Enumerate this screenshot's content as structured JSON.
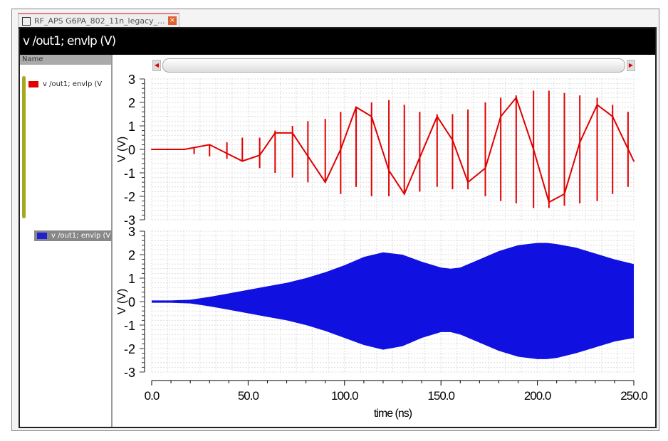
{
  "tab": {
    "title": "RF_APS G6PA_802_11n_legacy_...",
    "close": "×"
  },
  "window_title": "v /out1; envlp (V)",
  "panel": {
    "header": "Name",
    "traces": [
      {
        "label": "v /out1; envlp (V",
        "color": "#e00000"
      },
      {
        "label": "v /out1; envlp (V",
        "color": "#2020d0"
      }
    ]
  },
  "chart_data": [
    {
      "type": "line",
      "title": "v /out1; envlp (V)",
      "xlabel": "time (ns)",
      "ylabel": "V (V)",
      "xlim": [
        0,
        250
      ],
      "ylim": [
        -3,
        3
      ],
      "yticks": [
        "3",
        "2",
        "1",
        "0",
        "-1",
        "-2",
        "-3"
      ],
      "series": [
        {
          "name": "v /out1; envlp (V)",
          "color": "#e00000",
          "x": [
            0,
            17,
            30,
            47,
            56,
            64,
            73,
            90,
            98,
            106,
            114,
            123,
            131,
            148,
            156,
            164,
            173,
            181,
            189,
            198,
            206,
            214,
            222,
            231,
            239,
            250
          ],
          "y": [
            0,
            0,
            0.2,
            -0.5,
            -0.25,
            0.7,
            0.7,
            -1.4,
            0,
            1.8,
            1.4,
            -0.9,
            -1.9,
            1.4,
            0.4,
            -1.4,
            -0.8,
            1.4,
            2.2,
            0,
            -2.25,
            -1.9,
            0.3,
            1.9,
            1.4,
            -0.5
          ],
          "spikes": [
            [
              22,
              0.1,
              -0.2
            ],
            [
              30,
              0.2,
              -0.3
            ],
            [
              39,
              0.3,
              -0.4
            ],
            [
              47,
              0.5,
              -0.5
            ],
            [
              56,
              0.5,
              -0.8
            ],
            [
              64,
              0.8,
              -1.0
            ],
            [
              73,
              1.0,
              -1.2
            ],
            [
              81,
              1.2,
              -1.4
            ],
            [
              90,
              1.3,
              -1.4
            ],
            [
              98,
              1.6,
              -1.9
            ],
            [
              106,
              1.8,
              -1.6
            ],
            [
              114,
              2.0,
              -2.0
            ],
            [
              123,
              2.1,
              -2.0
            ],
            [
              131,
              1.9,
              -1.9
            ],
            [
              139,
              1.6,
              -1.8
            ],
            [
              148,
              1.5,
              -1.6
            ],
            [
              156,
              1.5,
              -1.7
            ],
            [
              164,
              1.7,
              -1.7
            ],
            [
              173,
              2.0,
              -2.0
            ],
            [
              181,
              2.2,
              -2.2
            ],
            [
              189,
              2.3,
              -2.3
            ],
            [
              198,
              2.5,
              -2.5
            ],
            [
              206,
              2.5,
              -2.5
            ],
            [
              214,
              2.4,
              -2.4
            ],
            [
              222,
              2.3,
              -2.3
            ],
            [
              231,
              2.2,
              -2.2
            ],
            [
              239,
              1.9,
              -1.9
            ],
            [
              247,
              1.6,
              -1.6
            ]
          ]
        }
      ]
    },
    {
      "type": "area",
      "xlabel": "time (ns)",
      "ylabel": "V (V)",
      "xlim": [
        0,
        250
      ],
      "ylim": [
        -3,
        3
      ],
      "yticks": [
        "3",
        "2",
        "1",
        "0",
        "-1",
        "-2",
        "-3"
      ],
      "xticks": [
        "0.0",
        "50.0",
        "100.0",
        "150.0",
        "200.0",
        "250.0"
      ],
      "series": [
        {
          "name": "v /out1; envlp (V)",
          "color": "#1010e0",
          "x": [
            0,
            10,
            20,
            30,
            40,
            50,
            60,
            70,
            80,
            90,
            100,
            110,
            120,
            130,
            140,
            150,
            155,
            160,
            170,
            180,
            190,
            200,
            205,
            210,
            220,
            230,
            240,
            250
          ],
          "upper": [
            0.05,
            0.05,
            0.08,
            0.2,
            0.35,
            0.5,
            0.65,
            0.8,
            1.0,
            1.25,
            1.55,
            1.9,
            2.1,
            2.0,
            1.7,
            1.45,
            1.4,
            1.45,
            1.8,
            2.15,
            2.4,
            2.5,
            2.5,
            2.45,
            2.3,
            2.05,
            1.8,
            1.6
          ],
          "lower": [
            -0.05,
            -0.05,
            -0.08,
            -0.2,
            -0.35,
            -0.5,
            -0.65,
            -0.8,
            -1.0,
            -1.25,
            -1.55,
            -1.85,
            -2.05,
            -1.9,
            -1.55,
            -1.3,
            -1.3,
            -1.4,
            -1.75,
            -2.1,
            -2.35,
            -2.45,
            -2.45,
            -2.4,
            -2.2,
            -1.95,
            -1.7,
            -1.55
          ]
        }
      ]
    }
  ]
}
